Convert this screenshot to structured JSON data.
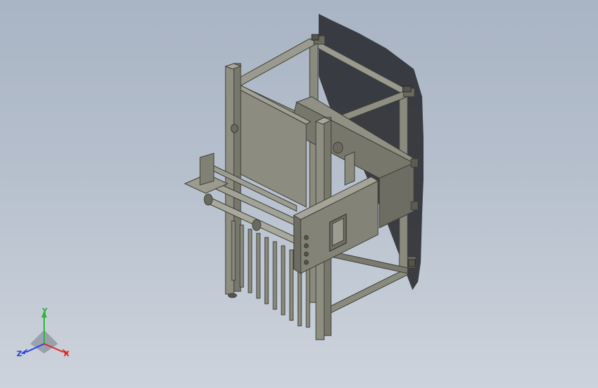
{
  "viewport": {
    "background_top": "#a9b4c4",
    "background_bottom": "#cdd3dc"
  },
  "model": {
    "description_icon": "machine-assembly-3d-view",
    "frame_color": "#8a8a7e",
    "panel_color": "#7d7d72",
    "shadow_color": "#2a2c30"
  },
  "triad": {
    "x_label": "X",
    "y_label": "Y",
    "z_label": "Z",
    "x_color": "#e0281e",
    "y_color": "#2fb33a",
    "z_color": "#2b46d6"
  }
}
